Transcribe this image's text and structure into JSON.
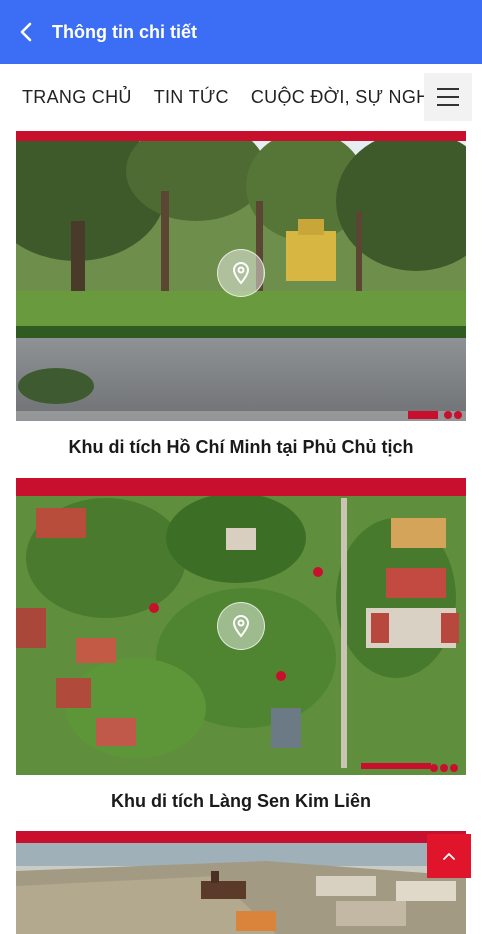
{
  "header": {
    "title": "Thông tin chi tiết"
  },
  "nav": {
    "items": [
      {
        "label": "TRANG CHỦ"
      },
      {
        "label": "TIN TỨC"
      },
      {
        "label": "CUỘC ĐỜI, SỰ NGHIỆP"
      }
    ]
  },
  "cards": [
    {
      "title": "Khu di tích Hồ Chí Minh tại Phủ Chủ tịch"
    },
    {
      "title": "Khu di tích Làng Sen Kim Liên"
    }
  ],
  "colors": {
    "header_bg": "#3c6ef5",
    "accent_red": "#c8102e",
    "scroll_top": "#e0142a"
  },
  "icons": {
    "back": "chevron-left-icon",
    "menu": "hamburger-icon",
    "pin": "map-pin-icon",
    "scroll_top": "chevron-up-icon"
  }
}
